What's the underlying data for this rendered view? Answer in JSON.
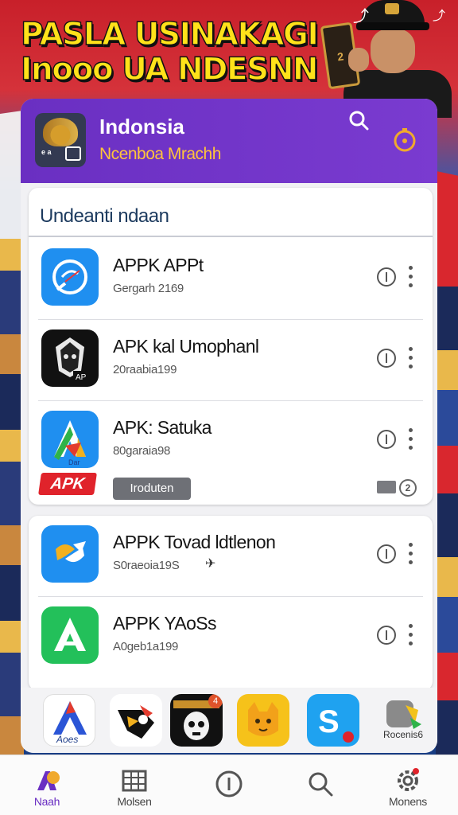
{
  "banner": {
    "headline_line1": "PASLA USINAKAGI",
    "headline_line2": "Inooo UA NDESNN",
    "phone_text": "2"
  },
  "header": {
    "title": "Indonsia",
    "subtitle": "Ncenboa Mrachh",
    "accent": "#7a3bd0",
    "subtitle_color": "#ffc43b"
  },
  "section": {
    "title": "Undeanti ndaan"
  },
  "apps": [
    {
      "name": "APPK APPt",
      "meta": "Gergarh 2169"
    },
    {
      "name": "APK kal Umophanl",
      "meta": "20raabia199"
    },
    {
      "name": "APK: Satuka",
      "meta": "80garaia98",
      "tag": "APK",
      "button": "Iroduten",
      "badge": "2"
    }
  ],
  "apps2": [
    {
      "name": "APPK Tovad ldtlenon",
      "meta": "S0raeoia19S"
    },
    {
      "name": "APPK YAoSs",
      "meta": "A0geb1a199"
    }
  ],
  "strip": {
    "label_first": "Aoes",
    "label_last": "Rocenis6",
    "notif_count": "4"
  },
  "nav": [
    {
      "label": "Naah",
      "icon": "home-icon"
    },
    {
      "label": "Molsen",
      "icon": "grid-icon"
    },
    {
      "label": "",
      "icon": "info-icon"
    },
    {
      "label": "",
      "icon": "search-icon"
    },
    {
      "label": "Monens",
      "icon": "settings-icon"
    }
  ]
}
